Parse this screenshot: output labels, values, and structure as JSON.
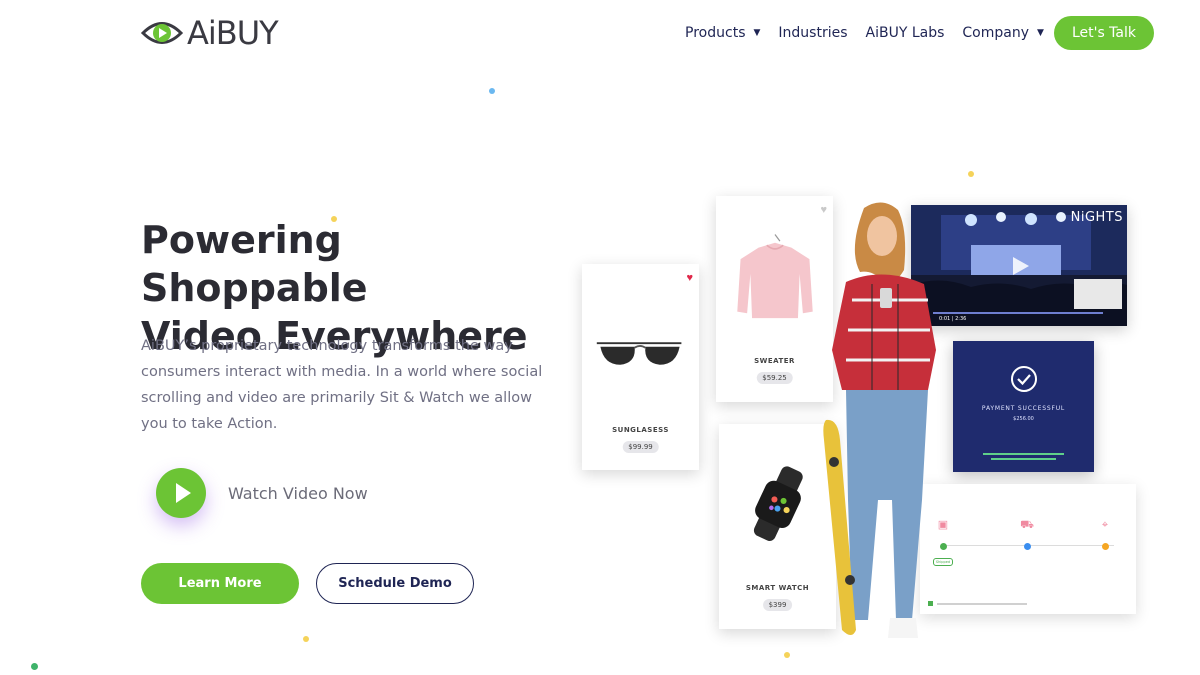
{
  "brand": {
    "logo_text": "AiBUY"
  },
  "nav": {
    "items": [
      {
        "label": "Products",
        "has_caret": true
      },
      {
        "label": "Industries",
        "has_caret": false
      },
      {
        "label": "AiBUY Labs",
        "has_caret": false
      },
      {
        "label": "Company",
        "has_caret": true
      }
    ],
    "cta": "Let's Talk"
  },
  "hero": {
    "title_line1": "Powering Shoppable",
    "title_line2": "Video Everywhere",
    "description": "AiBUY’s proprietary technology transforms the way consumers interact with media. In a world where social scrolling and video are primarily Sit & Watch we allow you to take Action.",
    "watch_label": "Watch Video Now",
    "learn_more": "Learn More",
    "schedule_demo": "Schedule Demo"
  },
  "products": [
    {
      "name": "SUNGLASESS",
      "price": "$99.99",
      "favorited": true
    },
    {
      "name": "SWEATER",
      "price": "$59.25",
      "favorited": false
    },
    {
      "name": "SMART WATCH",
      "price": "$399",
      "favorited": false
    }
  ],
  "video_card": {
    "overlay_text": "NiGHTS",
    "time": "0:01 | 2:36"
  },
  "payment_card": {
    "title": "PAYMENT SUCCESSFUL",
    "amount": "$256.00"
  },
  "tracking_card": {
    "badge": "Shipped"
  },
  "colors": {
    "accent_green": "#6cc435",
    "navy": "#1f2554",
    "payment_bg": "#1f2b6e",
    "heart_red": "#e0284a"
  },
  "icons": [
    "logo-eye-icon",
    "play-icon",
    "heart-icon",
    "check-circle-icon",
    "calendar-icon",
    "truck-icon",
    "location-pin-icon"
  ]
}
